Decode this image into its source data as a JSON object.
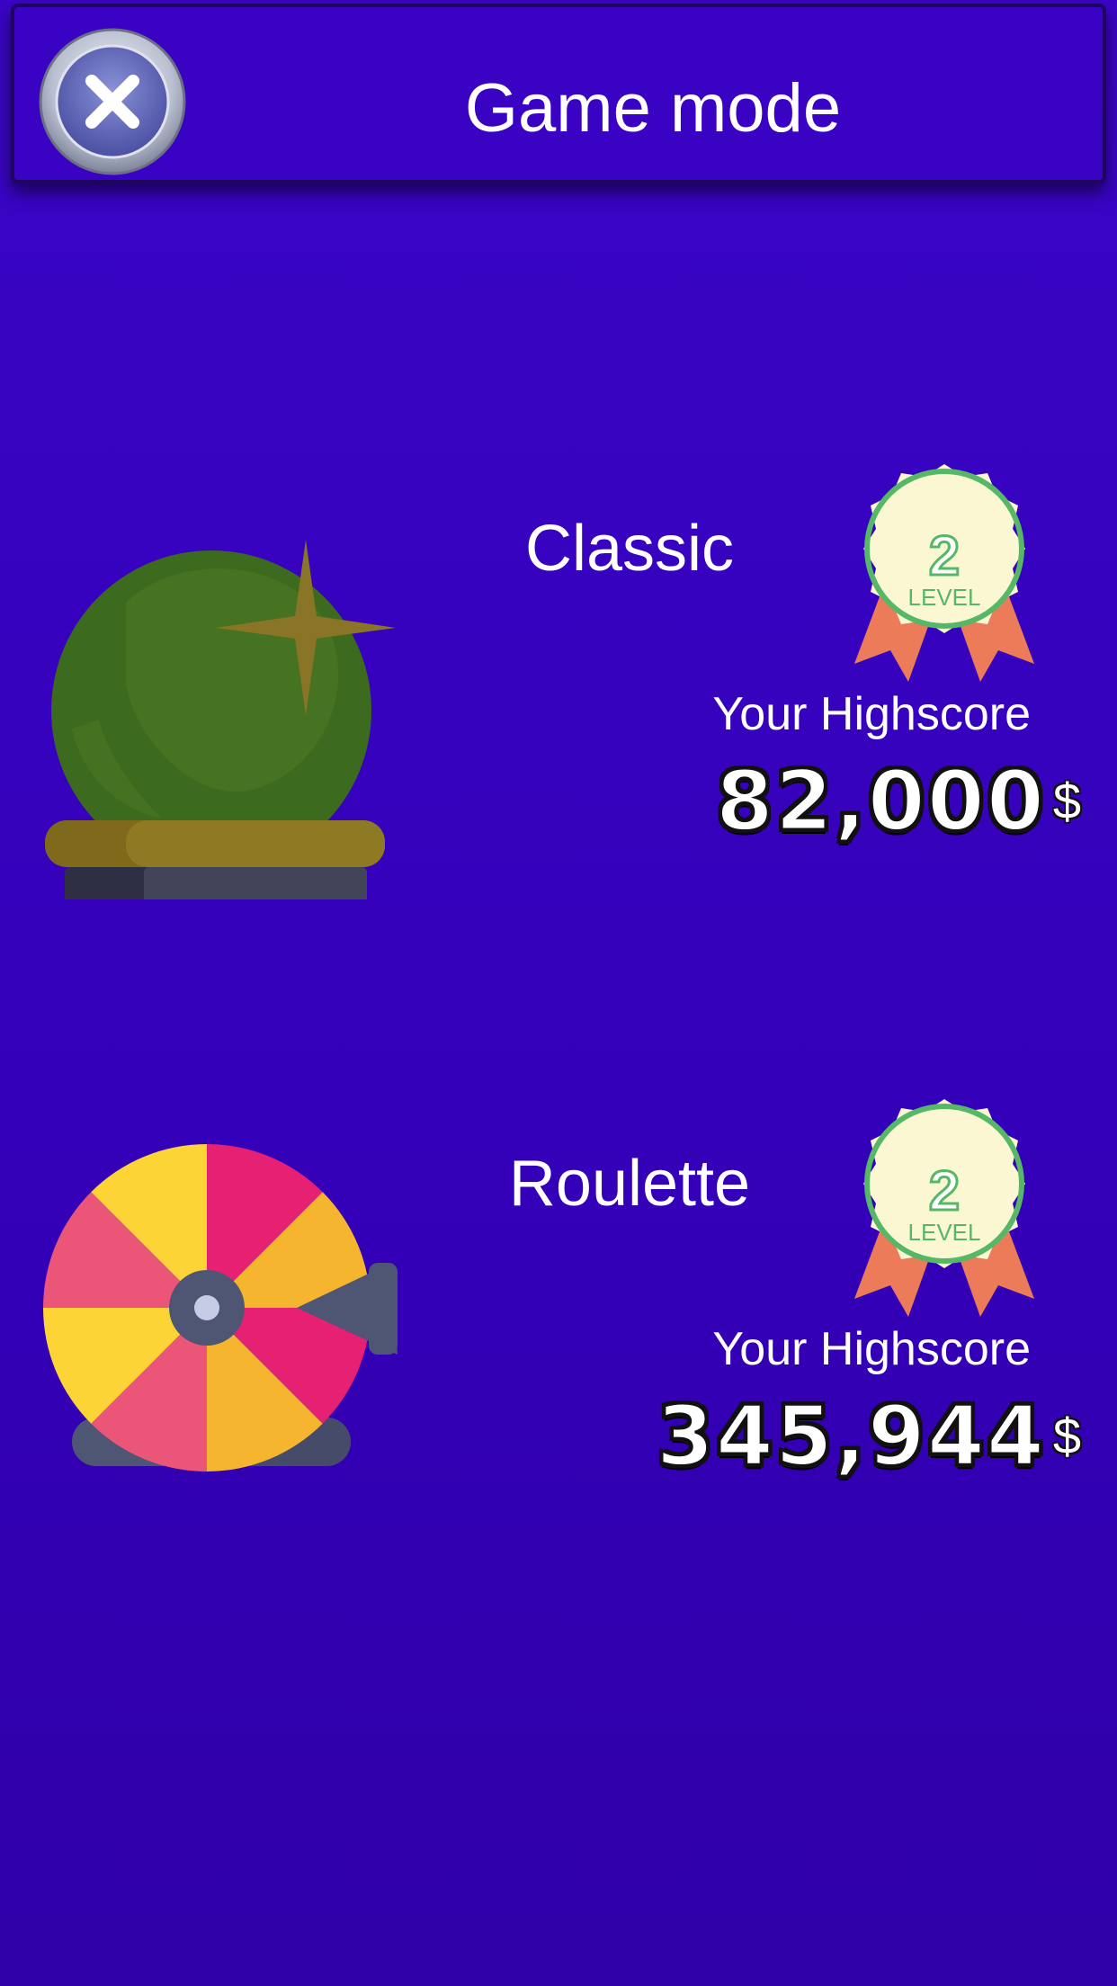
{
  "header": {
    "title": "Game mode",
    "close_icon": "close-icon"
  },
  "modes": [
    {
      "name": "Classic",
      "icon": "crystal-ball-icon",
      "level_badge": {
        "number": "2",
        "label": "LEVEL"
      },
      "highscore_label": "Your Highscore",
      "highscore_value": "82,000",
      "currency": "$"
    },
    {
      "name": "Roulette",
      "icon": "prize-wheel-icon",
      "level_badge": {
        "number": "2",
        "label": "LEVEL"
      },
      "highscore_label": "Your Highscore",
      "highscore_value": "345,944",
      "currency": "$"
    }
  ],
  "colors": {
    "background": "#3a05c6",
    "header_border": "#1d0560",
    "badge_green": "#56b867",
    "ribbon": "#ec7b5a"
  }
}
